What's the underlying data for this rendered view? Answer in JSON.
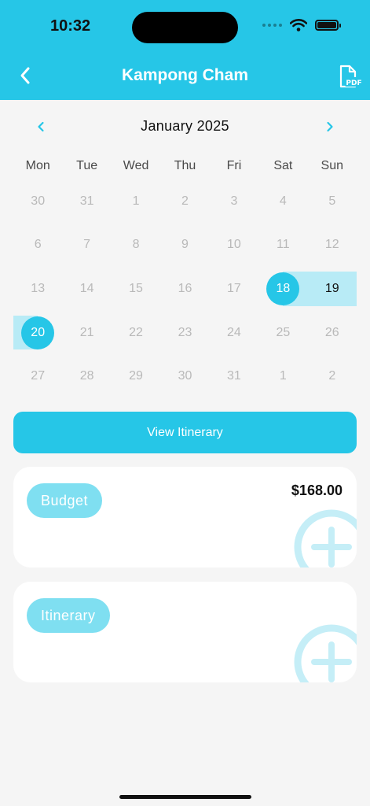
{
  "status_bar": {
    "time": "10:32"
  },
  "header": {
    "title": "Kampong Cham",
    "back_icon": "chevron-left-icon",
    "pdf_icon": "pdf-file-icon",
    "background": "#26c6e7"
  },
  "calendar": {
    "month_label": "January 2025",
    "weekdays": [
      "Mon",
      "Tue",
      "Wed",
      "Thu",
      "Fri",
      "Sat",
      "Sun"
    ],
    "weeks": [
      [
        "30",
        "31",
        "1",
        "2",
        "3",
        "4",
        "5"
      ],
      [
        "6",
        "7",
        "8",
        "9",
        "10",
        "11",
        "12"
      ],
      [
        "13",
        "14",
        "15",
        "16",
        "17",
        "18",
        "19"
      ],
      [
        "20",
        "21",
        "22",
        "23",
        "24",
        "25",
        "26"
      ],
      [
        "27",
        "28",
        "29",
        "30",
        "31",
        "1",
        "2"
      ]
    ],
    "selected_range": {
      "start": "18",
      "end": "20"
    },
    "accent": "#26c6e7",
    "range_fill": "#b8ebf6"
  },
  "actions": {
    "view_itinerary": "View Itinerary"
  },
  "cards": {
    "budget": {
      "label": "Budget",
      "amount": "$168.00",
      "add_icon": "plus-circle-icon"
    },
    "itinerary": {
      "label": "Itinerary",
      "add_icon": "plus-circle-icon"
    }
  }
}
